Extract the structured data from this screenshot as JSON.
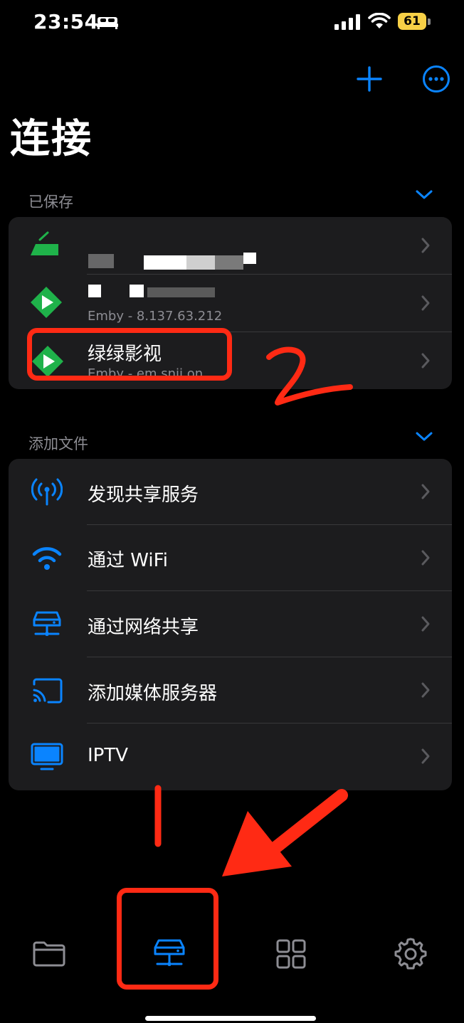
{
  "status_bar": {
    "time": "23:54",
    "battery": "61"
  },
  "page": {
    "title": "连接"
  },
  "saved_section": {
    "header": "已保存",
    "items": [
      {
        "title": "",
        "subtitle": ""
      },
      {
        "title": "",
        "subtitle": "Emby - 8.137.63.212"
      },
      {
        "title": "绿绿影视",
        "subtitle": "Emby - em.snii.on"
      }
    ]
  },
  "add_section": {
    "header": "添加文件",
    "items": [
      {
        "label": "发现共享服务",
        "icon": "antenna-icon"
      },
      {
        "label": "通过 WiFi",
        "icon": "wifi-icon"
      },
      {
        "label": "通过网络共享",
        "icon": "network-server-icon"
      },
      {
        "label": "添加媒体服务器",
        "icon": "cast-icon"
      },
      {
        "label": "IPTV",
        "icon": "tv-icon"
      }
    ]
  },
  "tab_bar": {
    "tabs": [
      "files-tab",
      "connections-tab",
      "apps-tab",
      "settings-tab"
    ],
    "selected": "connections-tab"
  },
  "annotations": {
    "step_2_label": "2",
    "step_1_label": "1"
  },
  "colors": {
    "accent": "#0a84ff",
    "annotation_red": "#ff2a14",
    "emby_green": "#1fb24a",
    "card_bg": "#1c1c1e"
  }
}
